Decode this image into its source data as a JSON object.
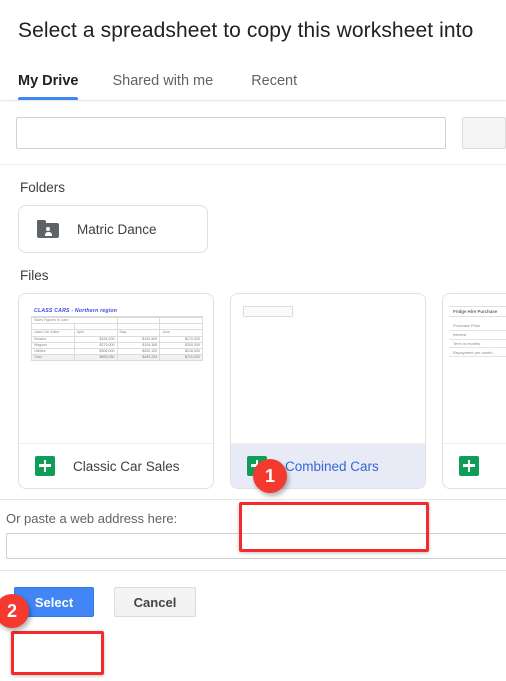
{
  "dialog": {
    "title": "Select a spreadsheet to copy this worksheet into"
  },
  "tabs": [
    {
      "label": "My Drive",
      "active": true
    },
    {
      "label": "Shared with me",
      "active": false
    },
    {
      "label": "Recent",
      "active": false
    }
  ],
  "search": {
    "value": "",
    "placeholder": "",
    "button_label": ""
  },
  "sections": {
    "folders_label": "Folders",
    "files_label": "Files"
  },
  "folders": [
    {
      "name": "Matric Dance",
      "icon": "shared-folder-icon"
    }
  ],
  "files": [
    {
      "name": "Classic Car Sales",
      "icon": "google-sheets-icon",
      "selected": false,
      "thumbnail": {
        "title": "CLASS CARS - Northern region",
        "subtitle": "Sales Figures in June",
        "header_row": [
          "Used Car Sales",
          "April",
          "May",
          "June"
        ],
        "rows": [
          [
            "Sedans",
            "$154,000",
            "$190,500",
            "$170,000"
          ],
          [
            "Wagons",
            "$279,000",
            "$109,365",
            "$300,000"
          ],
          [
            "Utilities",
            "$306,000",
            "$200,100",
            "$218,000"
          ],
          [
            "Total",
            "$895,050",
            "$499,254",
            "$710,000"
          ]
        ]
      }
    },
    {
      "name": "Combined Cars",
      "icon": "google-sheets-icon",
      "selected": true,
      "thumbnail": {
        "placeholder": true
      }
    },
    {
      "name": "",
      "icon": "google-sheets-icon",
      "selected": false,
      "thumbnail": {
        "title": "Fridge Hire Purchase",
        "rows": [
          "Purchase Price",
          "Interest",
          "Term in months",
          "Repayment per month"
        ]
      }
    }
  ],
  "url_section": {
    "label": "Or paste a web address here:",
    "value": "",
    "placeholder": ""
  },
  "actions": {
    "select_label": "Select",
    "cancel_label": "Cancel"
  },
  "annotations": [
    {
      "badge": "1",
      "target": "combined-cars-file-card"
    },
    {
      "badge": "2",
      "target": "select-button"
    }
  ],
  "colors": {
    "accent_blue": "#4285f4",
    "sheets_green": "#0f9d58",
    "annotation_red": "#f22c2c",
    "selected_row_bg": "#e8eaf6",
    "selected_text": "#3367d6"
  }
}
